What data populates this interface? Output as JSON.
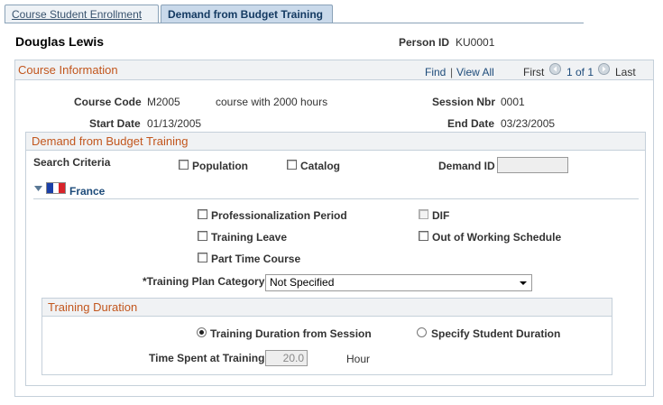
{
  "tabs": [
    {
      "label": "Course Student Enrollment"
    },
    {
      "label": "Demand from Budget Training"
    }
  ],
  "header": {
    "person_name": "Douglas Lewis",
    "person_id_label": "Person ID",
    "person_id_value": "KU0001"
  },
  "course_info": {
    "title": "Course Information",
    "find_label": "Find",
    "separator": "|",
    "view_all_label": "View All",
    "first_label": "First",
    "pagination": "1 of 1",
    "last_label": "Last",
    "course_code_label": "Course Code",
    "course_code_value": "M2005",
    "course_desc": "course with 2000 hours",
    "session_nbr_label": "Session Nbr",
    "session_nbr_value": "0001",
    "start_date_label": "Start Date",
    "start_date_value": "01/13/2005",
    "end_date_label": "End Date",
    "end_date_value": "03/23/2005"
  },
  "demand": {
    "title": "Demand from Budget Training",
    "search_criteria_label": "Search Criteria",
    "population_label": "Population",
    "population_checked": false,
    "catalog_label": "Catalog",
    "catalog_checked": false,
    "demand_id_label": "Demand ID",
    "demand_id_value": "",
    "country_label": "France",
    "professionalization_label": "Professionalization Period",
    "dif_label": "DIF",
    "training_leave_label": "Training Leave",
    "out_of_schedule_label": "Out of Working Schedule",
    "part_time_label": "Part Time Course",
    "plan_category_label": "*Training Plan Category",
    "plan_category_value": "Not Specified"
  },
  "duration": {
    "title": "Training Duration",
    "from_session_label": "Training Duration from Session",
    "from_session_selected": true,
    "specify_student_label": "Specify Student Duration",
    "specify_student_selected": false,
    "time_spent_label": "Time Spent at Training",
    "time_spent_value": "20.0",
    "unit_label": "Hour"
  },
  "colors": {
    "section_title": "#c2561d",
    "link": "#1d4b7a",
    "active_tab_bg": "#c9d9ea"
  }
}
